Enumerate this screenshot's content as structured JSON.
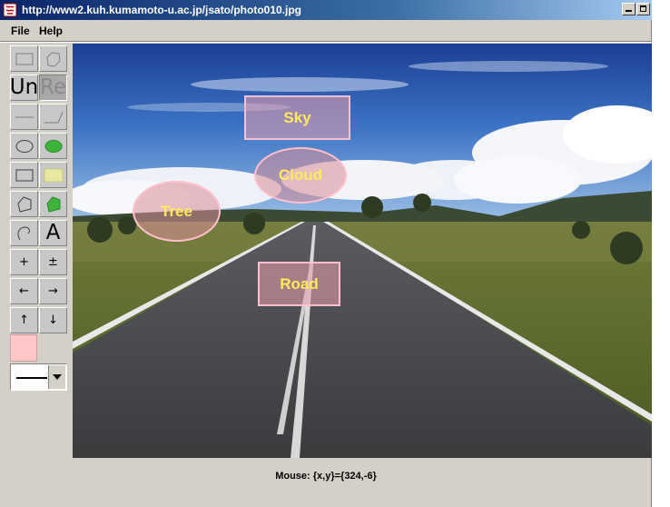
{
  "window": {
    "title": "http://www2.kuh.kumamoto-u.ac.jp/jsato/photo010.jpg",
    "icon": "java-applet-icon"
  },
  "menu": {
    "items": [
      "File",
      "Help"
    ]
  },
  "toolbar": {
    "undo_label": "Un",
    "redo_label": "Re",
    "text_label": "A",
    "plus_label": "+",
    "plus_minus_label": "±",
    "left_label": "←",
    "right_label": "→",
    "up_label": "↑",
    "down_label": "↓",
    "current_color": "#ffc8c8"
  },
  "annotations": [
    {
      "label": "Sky",
      "shape": "rectangle"
    },
    {
      "label": "Cloud",
      "shape": "ellipse"
    },
    {
      "label": "Tree",
      "shape": "ellipse"
    },
    {
      "label": "Road",
      "shape": "rectangle"
    }
  ],
  "status": {
    "mouse_text": "Mouse: {x,y}={324,-6}"
  }
}
